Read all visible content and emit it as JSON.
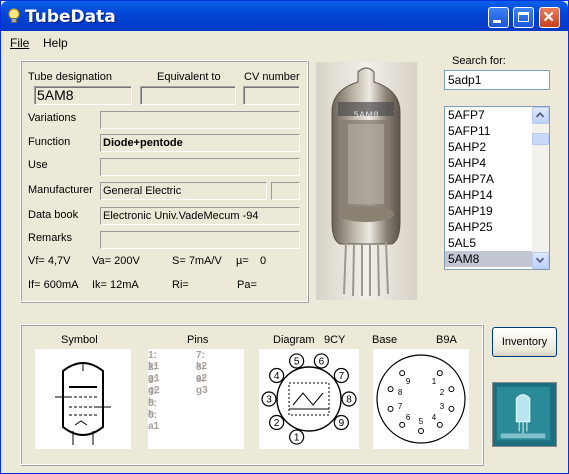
{
  "window": {
    "title": "TubeData"
  },
  "menu": {
    "file": "File",
    "help": "Help"
  },
  "search": {
    "label": "Search for:",
    "value": "5adp1"
  },
  "tube_list": {
    "items": [
      "5AFP7",
      "5AFP11",
      "5AHP2",
      "5AHP4",
      "5AHP7A",
      "5AHP14",
      "5AHP19",
      "5AHP25",
      "5AL5",
      "5AM8"
    ],
    "selected": "5AM8"
  },
  "header_labels": {
    "designation": "Tube designation",
    "equivalent": "Equivalent to",
    "cv": "CV number"
  },
  "fields": {
    "designation_value": "5AM8",
    "equivalent_value": "",
    "cv_value": "",
    "variations_label": "Variations",
    "variations_value": "",
    "function_label": "Function",
    "function_value": "Diode+pentode",
    "use_label": "Use",
    "use_value": "",
    "manufacturer_label": "Manufacturer",
    "manufacturer_value": "General Electric",
    "manufacturer_code": "",
    "databook_label": "Data book",
    "databook_value": "Electronic Univ.VadeMecum -94",
    "remarks_label": "Remarks",
    "remarks_value": ""
  },
  "params": {
    "vf": "Vf= 4,7V",
    "va": "Va= 200V",
    "s": "S= 7mA/V",
    "mu": "µ=",
    "mu_value": "0",
    "if": "If= 600mA",
    "ik": "Ik= 12mA",
    "ri": "Ri=",
    "pa": "Pa="
  },
  "bottom": {
    "symbol_title": "Symbol",
    "pins_title": "Pins",
    "diagram_title": "Diagram",
    "diagram_code": "9CY",
    "base_title": "Base",
    "base_code": "B9A",
    "pins_left": [
      "1: k1",
      "2: g1",
      "3: g2",
      "4: h",
      "5: h",
      "6: a1"
    ],
    "pins_right": [
      "7: k2",
      "8: a2",
      "9: g3"
    ],
    "diagram_pins": [
      "1",
      "2",
      "3",
      "4",
      "5",
      "6",
      "7",
      "8",
      "9"
    ],
    "base_pins": [
      "1",
      "2",
      "3",
      "4",
      "5",
      "6",
      "7",
      "8",
      "9"
    ]
  },
  "inventory_button": "Inventory",
  "photo": {
    "print": "5AM8"
  }
}
